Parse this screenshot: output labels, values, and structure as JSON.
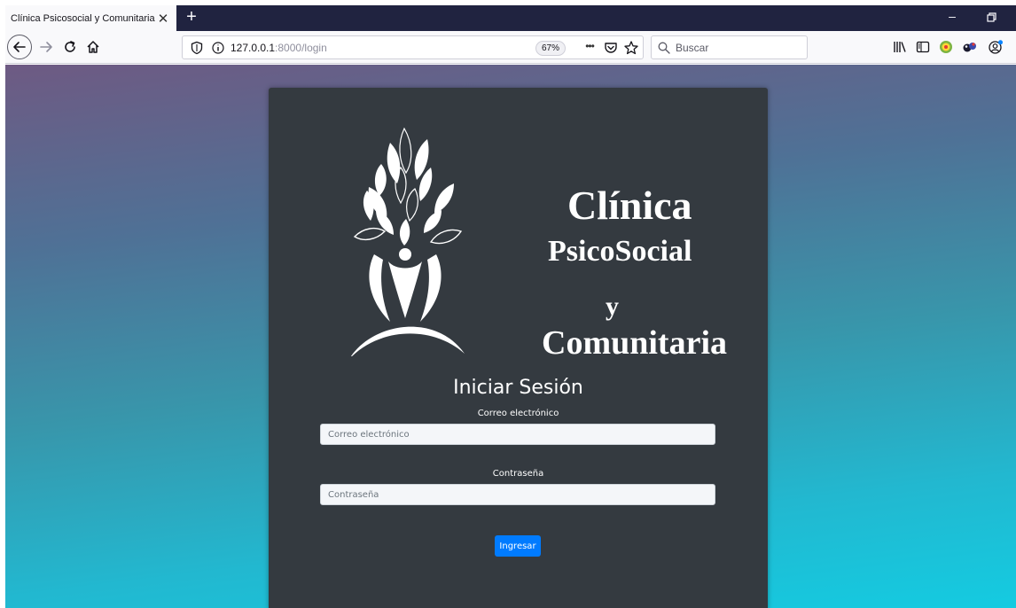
{
  "browser": {
    "tab": {
      "title": "Clínica Psicosocial y Comunitaria",
      "close_glyph": "✕"
    },
    "new_tab_glyph": "+",
    "window": {
      "minimize_glyph": "–"
    },
    "nav": {
      "url_host": "127.0.0.1",
      "url_rest": ":8000/login",
      "zoom": "67%",
      "more_glyph": "•••",
      "search_placeholder": "Buscar"
    },
    "icons": [
      "back-icon",
      "forward-icon",
      "reload-icon",
      "home-icon",
      "shield-icon",
      "info-icon",
      "pocket-icon",
      "star-icon",
      "search-icon",
      "library-icon",
      "sidebar-icon",
      "extension-icon",
      "extension-icon",
      "account-icon"
    ]
  },
  "page": {
    "logo": {
      "line1": "Clínica",
      "line2": "PsicoSocial",
      "line3": "y",
      "line4": "Comunitaria"
    },
    "login_title": "Iniciar Sesión",
    "email": {
      "label": "Correo electrónico",
      "placeholder": "Correo electrónico"
    },
    "password": {
      "label": "Contraseña",
      "placeholder": "Contraseña"
    },
    "submit_label": "Ingresar",
    "colors": {
      "card": "#343a40",
      "button": "#007bff"
    }
  }
}
